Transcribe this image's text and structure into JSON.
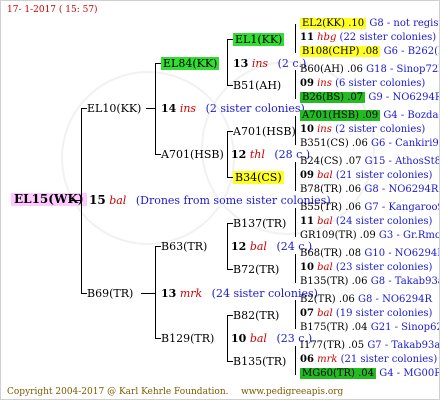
{
  "date": "17- 1-2017 ( 15: 57)",
  "root": {
    "name": "EL15(WK)"
  },
  "gen1": [
    {
      "name": "EL10(KK)",
      "count": "14",
      "breeder": "ins",
      "note": "(2 sister colonies)"
    },
    {
      "name": "B69(TR)",
      "count": "13",
      "breeder": "mrk",
      "note": "(24 sister colonies)"
    }
  ],
  "root_count": "15",
  "root_breeder": "bal",
  "root_note": "(Drones from some sister colonies)",
  "gen2": [
    {
      "name": "EL84(KK)",
      "count": "13",
      "breeder": "ins",
      "note": "(2 c.)"
    },
    {
      "name": "A701(HSB)",
      "count": "12",
      "breeder": "thl",
      "note": "(28 c.)"
    },
    {
      "name": "B63(TR)",
      "count": "12",
      "breeder": "bal",
      "note": "(24 c.)"
    },
    {
      "name": "B129(TR)",
      "count": "10",
      "breeder": "bal",
      "note": "(23 c.)"
    }
  ],
  "gen3": [
    {
      "name": "EL1(KK)"
    },
    {
      "name": "B51(AH)"
    },
    {
      "name": "A701(HSB)"
    },
    {
      "name": "B34(CS)"
    },
    {
      "name": "B137(TR)"
    },
    {
      "name": "B72(TR)"
    },
    {
      "name": "B82(TR)"
    },
    {
      "name": "B135(TR)"
    }
  ],
  "gen4": [
    {
      "a": "EL2(KK) .10",
      "b": "G8 - not registe"
    },
    {
      "a": "11",
      "breeder": "hbg",
      "c": "(22 sister colonies)"
    },
    {
      "a": "B108(CHP) .08",
      "b": "G6 - B262(NE)"
    },
    {
      "a": "B60(AH) .06",
      "b": "G18 - Sinop72R"
    },
    {
      "a": "09",
      "breeder": "ins",
      "c": "(6 sister colonies)"
    },
    {
      "a": "B26(BS) .07",
      "b": "G9 - NO6294R"
    },
    {
      "a": "A701(HSB) .09",
      "b": "G4 - Bozdag07R"
    },
    {
      "a": "10",
      "breeder": "ins",
      "c": "(2 sister colonies)"
    },
    {
      "a": "B351(CS) .06",
      "b": "G6 - Cankiri97Q"
    },
    {
      "a": "B24(CS) .07",
      "b": "G15 - AthosSt80R"
    },
    {
      "a": "09",
      "breeder": "bal",
      "c": "(21 sister colonies)"
    },
    {
      "a": "B78(TR) .06",
      "b": "G8 - NO6294R"
    },
    {
      "a": "B55(TR) .06",
      "b": "G7 - Kangaroo98R"
    },
    {
      "a": "11",
      "breeder": "bal",
      "c": "(24 sister colonies)"
    },
    {
      "a": "GR109(TR) .09",
      "b": "G3 - Gr.Rmounta"
    },
    {
      "a": "B68(TR) .08",
      "b": "G10 - NO6294R"
    },
    {
      "a": "10",
      "breeder": "bal",
      "c": "(23 sister colonies)"
    },
    {
      "a": "B135(TR) .06",
      "b": "G8 - Takab93aR"
    },
    {
      "a": "B2(TR) .06",
      "b": "G8 - NO6294R"
    },
    {
      "a": "07",
      "breeder": "bal",
      "c": "(19 sister colonies)"
    },
    {
      "a": "B175(TR) .04",
      "b": "G21 - Sinop62R"
    },
    {
      "a": "I177(TR) .05",
      "b": "G7 - Takab93aR"
    },
    {
      "a": "06",
      "breeder": "mrk",
      "c": "(21 sister colonies)"
    },
    {
      "a": "MG60(TR) .04",
      "b": "G4 - MG00R"
    }
  ],
  "copyright": "Copyright 2004-2017 @ Karl Kehrle Foundation.",
  "url": "www.pedigreeapis.org"
}
